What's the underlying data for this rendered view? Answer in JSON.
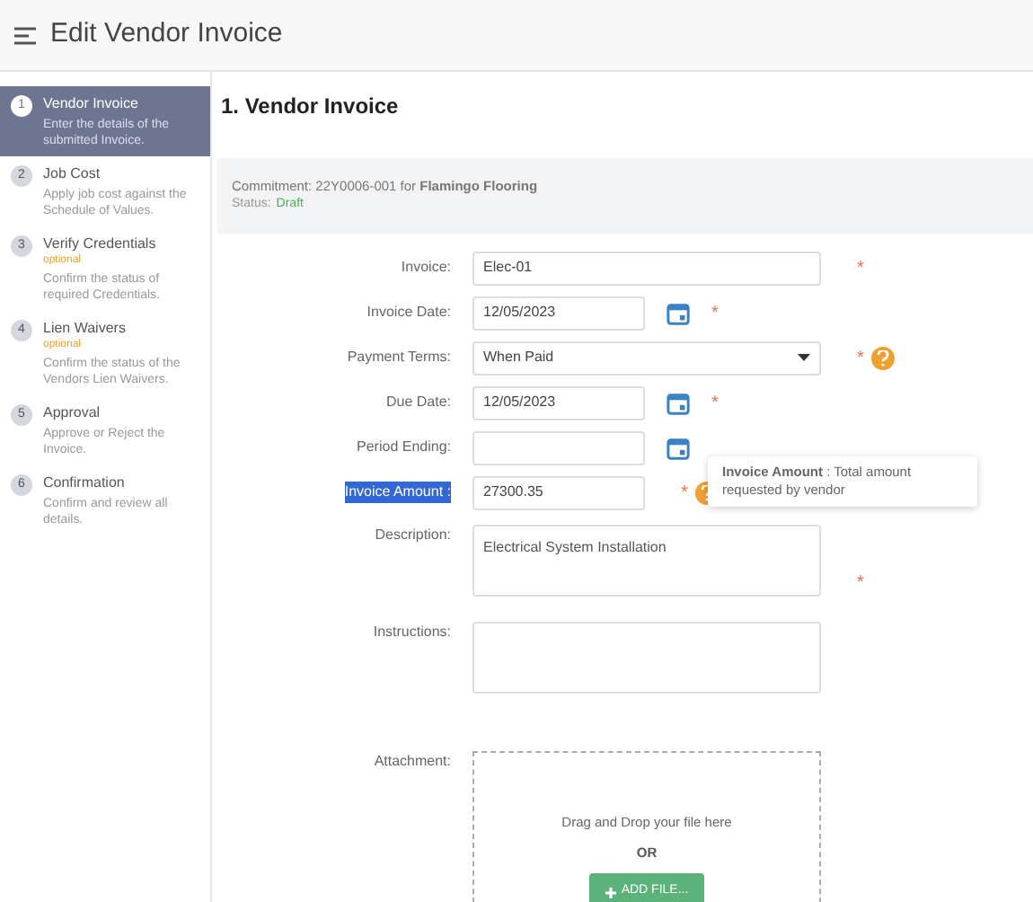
{
  "header": {
    "title": "Edit Vendor Invoice"
  },
  "steps": [
    {
      "number": "1",
      "title": "Vendor Invoice",
      "description": "Enter the details of the submitted Invoice.",
      "selected": true
    },
    {
      "number": "2",
      "title": "Job Cost",
      "description": "Apply job cost against the Schedule of Values.",
      "selected": false
    },
    {
      "number": "3",
      "title": "Verify Credentials",
      "optional": "optional",
      "description": "Confirm the status of required Credentials.",
      "selected": false
    },
    {
      "number": "4",
      "title": "Lien Waivers",
      "optional": "optional",
      "description": "Confirm the status of the Vendors Lien Waivers.",
      "selected": false
    },
    {
      "number": "5",
      "title": "Approval",
      "description": "Approve or Reject the Invoice.",
      "selected": false
    },
    {
      "number": "6",
      "title": "Confirmation",
      "description": "Confirm and review all details.",
      "selected": false
    }
  ],
  "section_title": "1. Vendor Invoice",
  "commitment": {
    "text": "Commitment: 22Y0006-001 for **Flamingo Flooring**",
    "status_label": "Status:",
    "status": "Draft"
  },
  "fields": [
    {
      "kind": "text",
      "label": "Invoice:",
      "value": "Elec-01",
      "required_mark": "*",
      "highlighted": false
    },
    {
      "kind": "date",
      "label": "Invoice Date:",
      "value": "12/05/2023",
      "required_mark": "*",
      "highlighted": false
    },
    {
      "kind": "select",
      "label": "Payment Terms:",
      "value": "When Paid",
      "required_mark": "*",
      "help": true,
      "highlighted": false
    },
    {
      "kind": "date",
      "label": "Due Date:",
      "value": "12/05/2023",
      "required_mark": "*",
      "highlighted": false
    },
    {
      "kind": "date",
      "label": "Period Ending:",
      "highlighted": false
    },
    {
      "kind": "amount",
      "label": "Invoice Amount :",
      "value": "27300.35",
      "required_mark": "*",
      "help": true,
      "highlighted": true
    },
    {
      "kind": "textarea",
      "label": "Description:",
      "value": "Electrical System Installation",
      "required_mark": "*",
      "highlighted": false
    },
    {
      "kind": "textarea",
      "label": "Instructions:",
      "highlighted": false
    }
  ],
  "tooltip": {
    "text": "**Invoice Amount** : Total amount requested by vendor"
  },
  "attachment": {
    "label": "Attachment:",
    "drop_text": "Drag and Drop your file here",
    "or": "OR",
    "button": "ADD FILE..."
  }
}
